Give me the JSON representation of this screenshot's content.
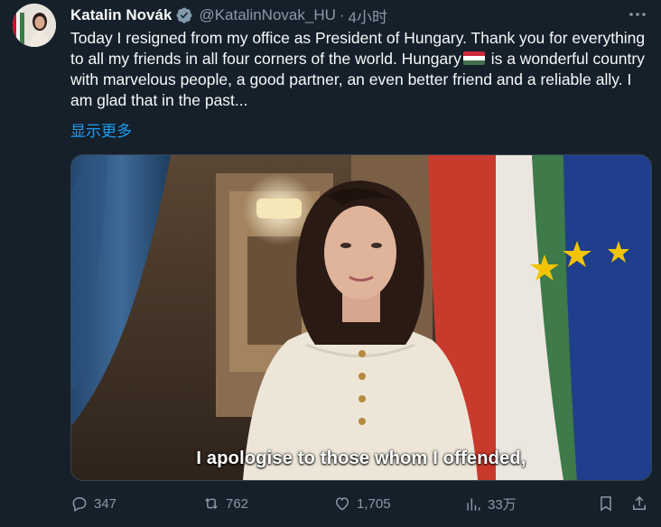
{
  "author": {
    "name": "Katalin Novák",
    "handle": "@KatalinNovak_HU",
    "separator": "·",
    "time": "4小时"
  },
  "tweet": {
    "text_before_flag": "Today I resigned from my office as President of Hungary. Thank you for everything to all my friends in all four corners of the world. Hungary",
    "text_after_flag": " is a wonderful country with marvelous people, a good partner, an even better friend and a reliable ally. I am glad that in the past...",
    "show_more": "显示更多"
  },
  "media": {
    "subtitle": "I apologise to those whom I offended,"
  },
  "actions": {
    "replies": "347",
    "retweets": "762",
    "likes": "1,705",
    "views": "33万"
  },
  "colors": {
    "background": "#15202b",
    "text": "#f7f9f9",
    "secondary": "#8b98a5",
    "link": "#1d9bf0",
    "verified": "#829aab"
  },
  "icons": {
    "more": "more-icon",
    "verified": "verified-badge-icon",
    "reply": "reply-icon",
    "retweet": "retweet-icon",
    "like": "like-icon",
    "views": "views-icon",
    "bookmark": "bookmark-icon",
    "share": "share-icon"
  }
}
